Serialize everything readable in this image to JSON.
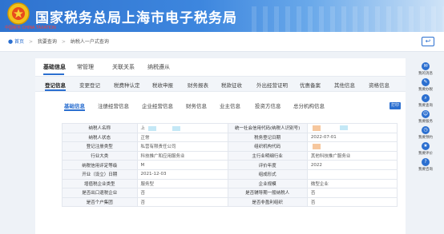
{
  "header": {
    "title": "国家税务总局上海市电子税务局",
    "emblem_caption": "中国税务 CHINA TAXATION",
    "emblem_icon": "tax-emblem-icon",
    "color": "#2f73cf"
  },
  "breadcrumb": {
    "items": [
      "首页",
      "我要查询",
      "纳税人一户式查询"
    ]
  },
  "tabs_level1": [
    "基础信息",
    "常管理",
    "关联关系",
    "纳税遵从"
  ],
  "tabs_level2": [
    "登记信息",
    "变更登记",
    "税费种认定",
    "税收申报",
    "财务报表",
    "税款征收",
    "外出经营证明",
    "优惠备案",
    "其他信息",
    "资格信息"
  ],
  "tabs_level3": [
    "基础信息",
    "注册经营信息",
    "企业经营信息",
    "财务信息",
    "业主信息",
    "投资方信息",
    "总分机构信息"
  ],
  "print_label": "打印",
  "table": {
    "rows": [
      [
        "纳税人名称",
        "上",
        "统一社会信用代码(纳税人识别号)",
        ""
      ],
      [
        "纳税人状态",
        "正常",
        "税务登记日期",
        "2022-07-01"
      ],
      [
        "登记注册类型",
        "私营有限责任公司",
        "组织机构代码",
        ""
      ],
      [
        "行业大类",
        "科技推广和应用服务业",
        "主行业明细行业",
        "其他科技推广服务业"
      ],
      [
        "纳税信用评定等级",
        "M",
        "评价年度",
        "2022"
      ],
      [
        "开业（设立）日期",
        "2021-12-03",
        "组成形式",
        ""
      ],
      [
        "增值税企业类型",
        "服务型",
        "企业规模",
        "微型企业"
      ],
      [
        "是否出口退税企业",
        "否",
        "是否辅导期一般纳税人",
        "否"
      ],
      [
        "是否个户集团",
        "否",
        "是否非盈利组织",
        "否"
      ]
    ]
  },
  "sidebar": {
    "items": [
      {
        "label": "我的消息",
        "icon": "message-icon"
      },
      {
        "label": "我要办税",
        "icon": "tax-handle-icon"
      },
      {
        "label": "我要查询",
        "icon": "query-icon"
      },
      {
        "label": "我要服务",
        "icon": "service-icon"
      },
      {
        "label": "我要预约",
        "icon": "appointment-icon"
      },
      {
        "label": "我要评价",
        "icon": "evaluate-icon"
      },
      {
        "label": "我要咨询",
        "icon": "consult-icon"
      }
    ]
  }
}
